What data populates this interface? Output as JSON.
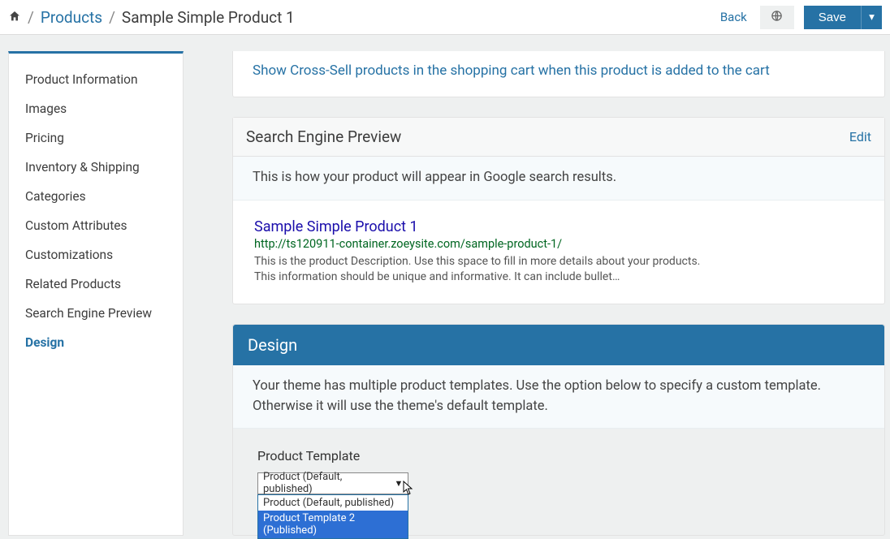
{
  "header": {
    "breadcrumb": {
      "products": "Products",
      "current": "Sample Simple Product 1"
    },
    "back": "Back",
    "save": "Save"
  },
  "sidebar": {
    "items": [
      {
        "label": "Product Information"
      },
      {
        "label": "Images"
      },
      {
        "label": "Pricing"
      },
      {
        "label": "Inventory & Shipping"
      },
      {
        "label": "Categories"
      },
      {
        "label": "Custom Attributes"
      },
      {
        "label": "Customizations"
      },
      {
        "label": "Related Products"
      },
      {
        "label": "Search Engine Preview"
      },
      {
        "label": "Design"
      }
    ]
  },
  "cross_sell": {
    "link": "Show Cross-Sell products in the shopping cart when this product is added to the cart"
  },
  "seo": {
    "panel_title": "Search Engine Preview",
    "edit": "Edit",
    "intro": "This is how your product will appear in Google search results.",
    "title": "Sample Simple Product 1",
    "url": "http://ts120911-container.zoeysite.com/sample-product-1/",
    "desc": "This is the product Description. Use this space to fill in more details about your products. This information should be unique and informative. It can include bullet…"
  },
  "design": {
    "panel_title": "Design",
    "intro": "Your theme has multiple product templates. Use the option below to specify a custom template. Otherwise it will use the theme's default template.",
    "template_label": "Product Template",
    "selected": "Product (Default, published)",
    "options": [
      "Product (Default, published)",
      "Product Template 2 (Published)"
    ]
  }
}
